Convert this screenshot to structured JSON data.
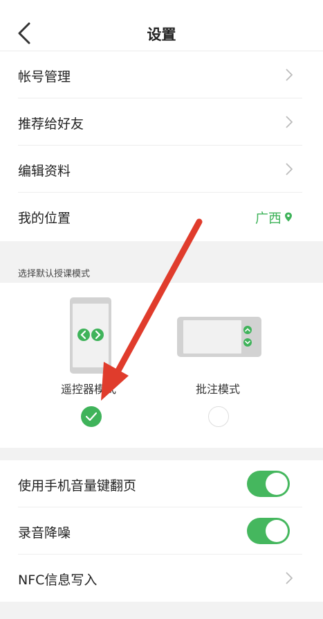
{
  "header": {
    "title": "设置"
  },
  "menu": {
    "account": "帐号管理",
    "recommend": "推荐给好友",
    "edit_profile": "编辑资料",
    "location_label": "我的位置",
    "location_value": "广西"
  },
  "teaching_mode": {
    "section_label": "选择默认授课模式",
    "remote_label": "遥控器模式",
    "annotation_label": "批注模式",
    "selected": "遥控器模式"
  },
  "settings": {
    "volume_page_label": "使用手机音量键翻页",
    "volume_page_on": true,
    "noise_reduction_label": "录音降噪",
    "noise_reduction_on": true,
    "nfc_label": "NFC信息写入"
  },
  "colors": {
    "accent_green": "#3fb35a",
    "annotation_arrow": "#e03c2c",
    "section_background": "#f2f2f2"
  }
}
